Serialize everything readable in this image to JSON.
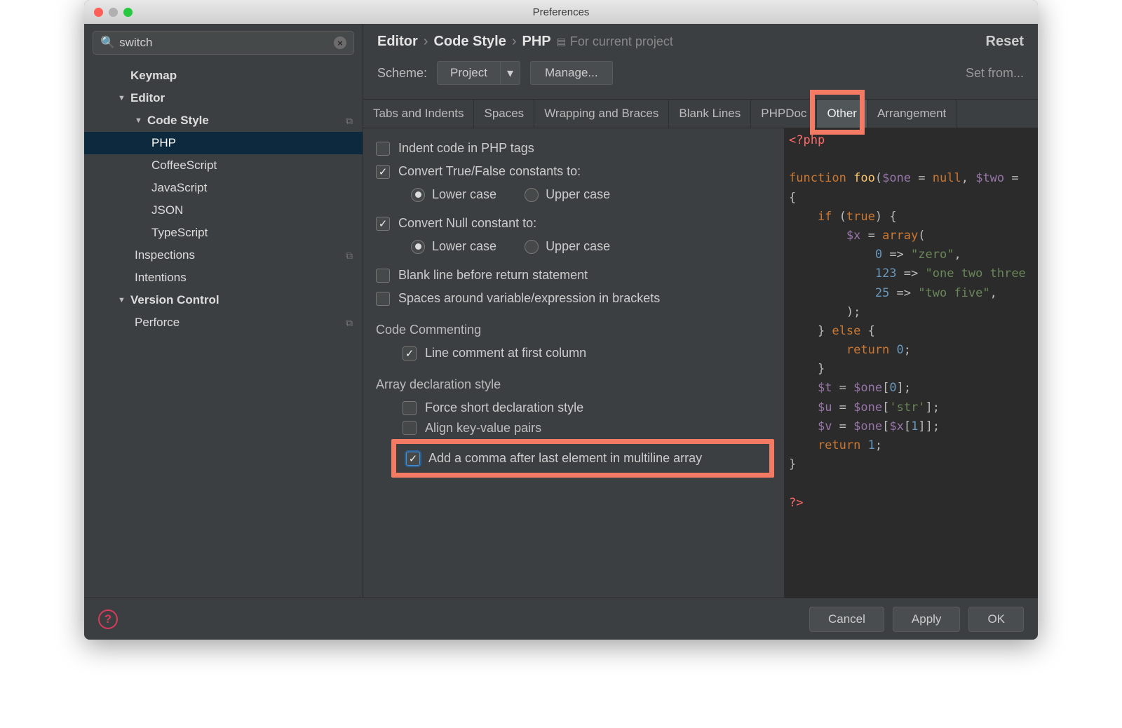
{
  "window": {
    "title": "Preferences"
  },
  "search": {
    "value": "switch",
    "clear": "×"
  },
  "tree": {
    "keymap": "Keymap",
    "editor": "Editor",
    "codestyle": "Code Style",
    "php": "PHP",
    "coffee": "CoffeeScript",
    "js": "JavaScript",
    "json": "JSON",
    "ts": "TypeScript",
    "inspections": "Inspections",
    "intentions": "Intentions",
    "vc": "Version Control",
    "perforce": "Perforce"
  },
  "breadcrumb": {
    "a": "Editor",
    "b": "Code Style",
    "c": "PHP",
    "scope": "For current project",
    "reset": "Reset"
  },
  "scheme": {
    "label": "Scheme:",
    "value": "Project",
    "manage": "Manage...",
    "setfrom": "Set from..."
  },
  "tabs": {
    "t0": "Tabs and Indents",
    "t1": "Spaces",
    "t2": "Wrapping and Braces",
    "t3": "Blank Lines",
    "t4": "PHPDoc",
    "t5": "Other",
    "t6": "Arrangement"
  },
  "opts": {
    "indentTags": "Indent code in PHP tags",
    "convTF": "Convert True/False constants to:",
    "lower": "Lower case",
    "upper": "Upper case",
    "convNull": "Convert Null constant to:",
    "blankRet": "Blank line before return statement",
    "spacesVar": "Spaces around variable/expression in brackets",
    "codeComment": "Code Commenting",
    "lineComment": "Line comment at first column",
    "arrayDecl": "Array declaration style",
    "forceShort": "Force short declaration style",
    "alignKV": "Align key-value pairs",
    "addComma": "Add a comma after last element in multiline array"
  },
  "footer": {
    "cancel": "Cancel",
    "apply": "Apply",
    "ok": "OK"
  },
  "code": {
    "l1a": "<?php",
    "l2a": "function ",
    "l2b": "foo",
    "l2c": "(",
    "l2d": "$one",
    "l2e": " = ",
    "l2f": "null",
    "l2g": ", ",
    "l2h": "$two",
    "l2i": " =",
    "l3": "{",
    "l4a": "    if ",
    "l4b": "(",
    "l4c": "true",
    "l4d": ") {",
    "l5a": "        ",
    "l5b": "$x",
    "l5c": " = ",
    "l5d": "array",
    "l5e": "(",
    "l6a": "            ",
    "l6b": "0",
    "l6c": " => ",
    "l6d": "\"zero\"",
    "l6e": ",",
    "l7a": "            ",
    "l7b": "123",
    "l7c": " => ",
    "l7d": "\"one two three",
    "l8a": "            ",
    "l8b": "25",
    "l8c": " => ",
    "l8d": "\"two five\"",
    "l8e": ",",
    "l9": "        );",
    "l10a": "    } ",
    "l10b": "else",
    "l10c": " {",
    "l11a": "        return ",
    "l11b": "0",
    "l11c": ";",
    "l12": "    }",
    "l13a": "    ",
    "l13b": "$t",
    "l13c": " = ",
    "l13d": "$one",
    "l13e": "[",
    "l13f": "0",
    "l13g": "];",
    "l14a": "    ",
    "l14b": "$u",
    "l14c": " = ",
    "l14d": "$one",
    "l14e": "[",
    "l14f": "'str'",
    "l14g": "];",
    "l15a": "    ",
    "l15b": "$v",
    "l15c": " = ",
    "l15d": "$one",
    "l15e": "[",
    "l15f": "$x",
    "l15g": "[",
    "l15h": "1",
    "l15i": "]];",
    "l16a": "    return ",
    "l16b": "1",
    "l16c": ";",
    "l17": "}",
    "l18": "?>"
  }
}
